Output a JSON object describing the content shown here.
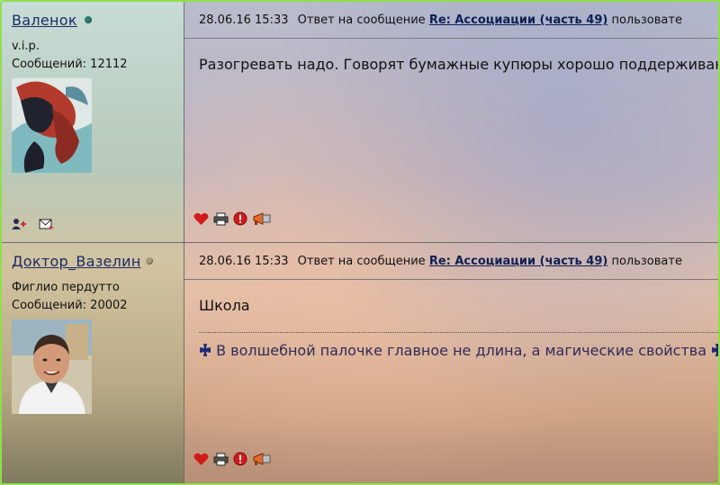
{
  "posts": [
    {
      "author": {
        "name": "Валенок",
        "rank": "v.i.p.",
        "messages_label": "Сообщений:",
        "messages_count": "12112",
        "status_color": "#2f7d6d"
      },
      "header": {
        "datetime": "28.06.16 15:33",
        "reply_label": "Ответ на сообщение",
        "reply_link": "Re: Ассоциации (часть 49)",
        "suffix": "пользовате"
      },
      "body": "Разогревать надо. Говорят бумажные купюры хорошо поддерживают"
    },
    {
      "author": {
        "name": "Доктор_Вазелин",
        "rank": "Фиглио пердутто",
        "messages_label": "Сообщений:",
        "messages_count": "20002",
        "status_color": "#a89a7a"
      },
      "header": {
        "datetime": "28.06.16 15:33",
        "reply_label": "Ответ на сообщение",
        "reply_link": "Re: Ассоциации (часть 49)",
        "suffix": "пользовате"
      },
      "body": "Школа",
      "signature": "В волшебной палочке главное не длина, а магические свойства"
    }
  ],
  "icons": {
    "heart": "heart-icon",
    "print": "printer-icon",
    "alert": "alert-icon",
    "megaphone": "megaphone-icon",
    "add_user": "add-user-icon",
    "send_mail": "send-message-icon",
    "cross": "iron-cross-icon"
  },
  "colors": {
    "frame": "#8fdf4c",
    "link": "#0f1f55",
    "heart": "#d31a1a"
  }
}
